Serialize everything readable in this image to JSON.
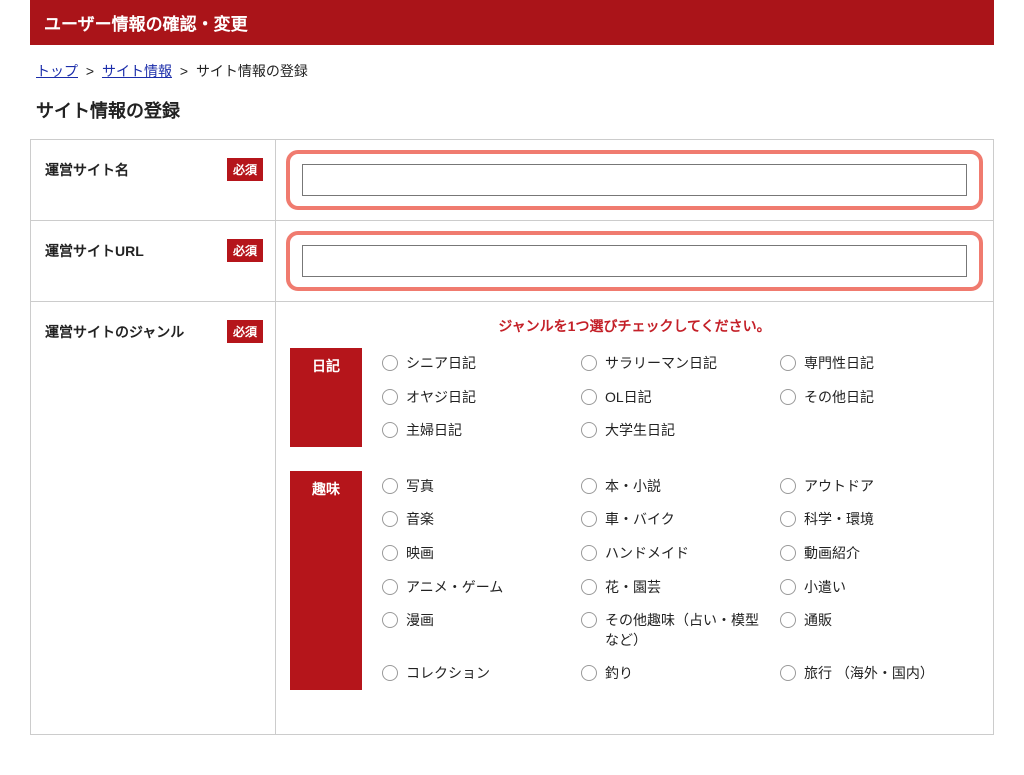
{
  "header": {
    "title": "ユーザー情報の確認・変更"
  },
  "breadcrumb": {
    "top": "トップ",
    "siteinfo": "サイト情報",
    "current": "サイト情報の登録",
    "sep": ">"
  },
  "page": {
    "title": "サイト情報の登録"
  },
  "badges": {
    "required": "必須"
  },
  "rows": {
    "sitename": {
      "label": "運営サイト名",
      "value": ""
    },
    "siteurl": {
      "label": "運営サイトURL",
      "value": ""
    },
    "genre": {
      "label": "運営サイトのジャンル"
    }
  },
  "genre": {
    "instruction": "ジャンルを1つ選びチェックしてください。",
    "groups": [
      {
        "name": "日記",
        "options": [
          "シニア日記",
          "サラリーマン日記",
          "専門性日記",
          "オヤジ日記",
          "OL日記",
          "その他日記",
          "主婦日記",
          "大学生日記",
          ""
        ]
      },
      {
        "name": "趣味",
        "options": [
          "写真",
          "本・小説",
          "アウトドア",
          "音楽",
          "車・バイク",
          "科学・環境",
          "映画",
          "ハンドメイド",
          "動画紹介",
          "アニメ・ゲーム",
          "花・園芸",
          "小遣い",
          "漫画",
          "その他趣味（占い・模型など）",
          "通販",
          "コレクション",
          "釣り",
          "旅行 （海外・国内）"
        ]
      }
    ]
  }
}
